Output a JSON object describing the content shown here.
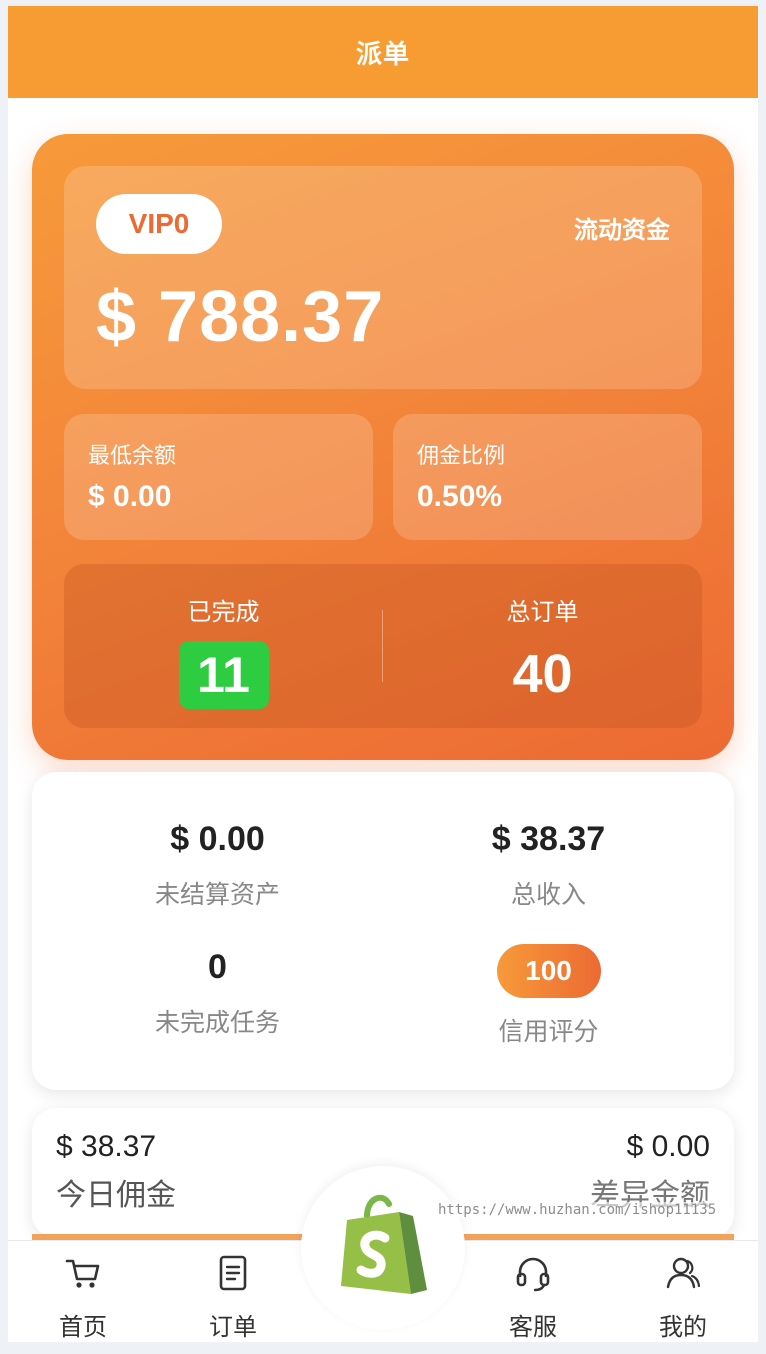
{
  "header": {
    "title": "派单"
  },
  "balance_card": {
    "vip_label": "VIP0",
    "fund_label": "流动资金",
    "balance": "$ 788.37",
    "min_balance": {
      "label": "最低余额",
      "value": "$ 0.00"
    },
    "commission_rate": {
      "label": "佣金比例",
      "value": "0.50%"
    },
    "completed": {
      "label": "已完成",
      "value": "11"
    },
    "total_orders": {
      "label": "总订单",
      "value": "40"
    }
  },
  "summary": {
    "unsettled": {
      "value": "$ 0.00",
      "label": "未结算资产"
    },
    "total_income": {
      "value": "$ 38.37",
      "label": "总收入"
    },
    "incomplete_tasks": {
      "value": "0",
      "label": "未完成任务"
    },
    "credit_score": {
      "value": "100",
      "label": "信用评分"
    }
  },
  "commission": {
    "today": {
      "value": "$ 38.37",
      "label": "今日佣金"
    },
    "difference": {
      "value": "$ 0.00",
      "label": "差异金额"
    }
  },
  "bottom_nav": {
    "home": {
      "label": "首页",
      "icon": "cart-icon"
    },
    "orders": {
      "label": "订单",
      "icon": "document-icon"
    },
    "center": {
      "icon": "shop-bag-icon"
    },
    "service": {
      "label": "客服",
      "icon": "headset-icon"
    },
    "mine": {
      "label": "我的",
      "icon": "user-icon"
    }
  },
  "watermark": "https://www.huzhan.com/ishop11135",
  "colors": {
    "header": "#f79c33",
    "card_gradient_start": "#f79a3a",
    "card_gradient_end": "#ec6a33",
    "completed_badge": "#2ecc40",
    "vip_text": "#ec6a33"
  }
}
